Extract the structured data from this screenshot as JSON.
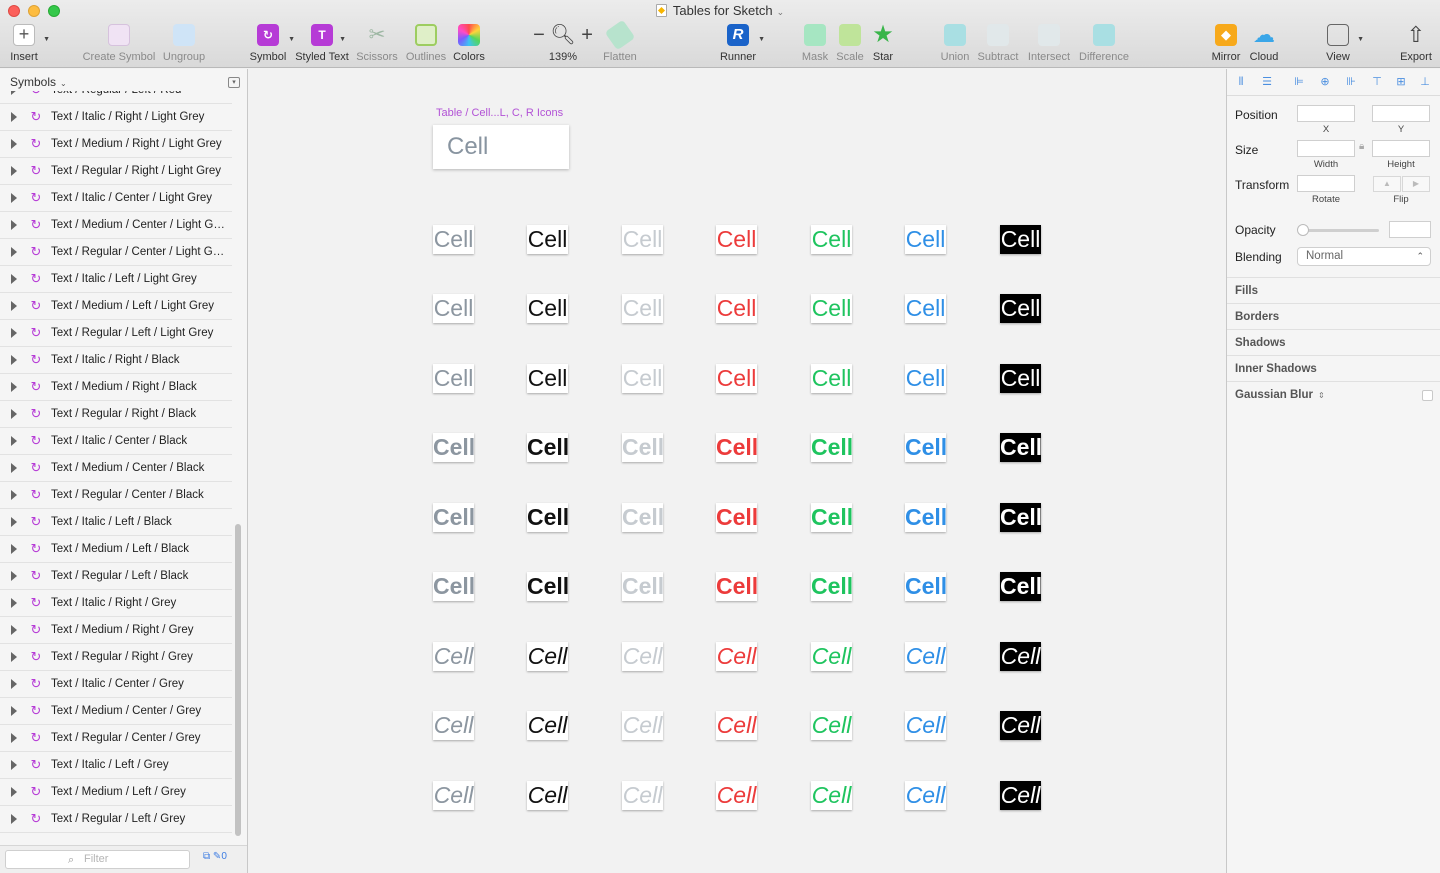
{
  "window": {
    "title": "Tables for Sketch"
  },
  "toolbar": {
    "insert": "Insert",
    "create_symbol": "Create Symbol",
    "ungroup": "Ungroup",
    "symbol": "Symbol",
    "styled_text": "Styled Text",
    "scissors": "Scissors",
    "outlines": "Outlines",
    "colors": "Colors",
    "zoom_level": "139%",
    "flatten": "Flatten",
    "runner": "Runner",
    "mask": "Mask",
    "scale": "Scale",
    "star": "Star",
    "union": "Union",
    "subtract": "Subtract",
    "intersect": "Intersect",
    "difference": "Difference",
    "mirror": "Mirror",
    "cloud": "Cloud",
    "view": "View",
    "export": "Export"
  },
  "sidebar": {
    "title": "Symbols",
    "filter_placeholder": "Filter",
    "footer_count": "0",
    "layers": [
      "Text / Regular / Left / Red",
      "Text / Italic / Right / Light Grey",
      "Text / Medium / Right / Light Grey",
      "Text / Regular / Right / Light Grey",
      "Text / Italic / Center / Light Grey",
      "Text / Medium / Center / Light Grey",
      "Text / Regular / Center / Light Grey",
      "Text / Italic / Left / Light Grey",
      "Text / Medium / Left / Light Grey",
      "Text / Regular / Left / Light Grey",
      "Text / Italic / Right / Black",
      "Text / Medium / Right / Black",
      "Text / Regular / Right / Black",
      "Text / Italic / Center / Black",
      "Text / Medium / Center / Black",
      "Text / Regular / Center / Black",
      "Text / Italic / Left / Black",
      "Text / Medium / Left / Black",
      "Text / Regular / Left / Black",
      "Text / Italic / Right / Grey",
      "Text / Medium / Right / Grey",
      "Text / Regular / Right / Grey",
      "Text / Italic / Center / Grey",
      "Text / Medium / Center / Grey",
      "Text / Regular / Center / Grey",
      "Text / Italic / Left / Grey",
      "Text / Medium / Left / Grey",
      "Text / Regular / Left / Grey"
    ]
  },
  "canvas": {
    "artboard_label": "Table / Cell...L, C, R Icons",
    "artboard_cell_text": "Cell",
    "cell_text": "Cell",
    "columns": [
      {
        "name": "grey",
        "color": "#8c96a0",
        "bg": "#ffffff"
      },
      {
        "name": "black",
        "color": "#111111",
        "bg": "#ffffff"
      },
      {
        "name": "light-grey",
        "color": "#c6cbd0",
        "bg": "#ffffff"
      },
      {
        "name": "red",
        "color": "#ec3b3b",
        "bg": "#ffffff"
      },
      {
        "name": "green",
        "color": "#1fc45f",
        "bg": "#ffffff"
      },
      {
        "name": "blue",
        "color": "#2f8fe6",
        "bg": "#ffffff"
      },
      {
        "name": "white-on-black",
        "color": "#ffffff",
        "bg": "#000000"
      }
    ],
    "rows": [
      {
        "style": "regular"
      },
      {
        "style": "regular"
      },
      {
        "style": "regular"
      },
      {
        "style": "medium"
      },
      {
        "style": "medium"
      },
      {
        "style": "medium"
      },
      {
        "style": "italic"
      },
      {
        "style": "italic"
      },
      {
        "style": "italic"
      }
    ]
  },
  "inspector": {
    "position": "Position",
    "x": "X",
    "y": "Y",
    "size": "Size",
    "width": "Width",
    "height": "Height",
    "transform": "Transform",
    "rotate": "Rotate",
    "flip": "Flip",
    "opacity": "Opacity",
    "blending": "Blending",
    "blending_value": "Normal",
    "sections": [
      "Fills",
      "Borders",
      "Shadows",
      "Inner Shadows",
      "Gaussian Blur"
    ]
  }
}
